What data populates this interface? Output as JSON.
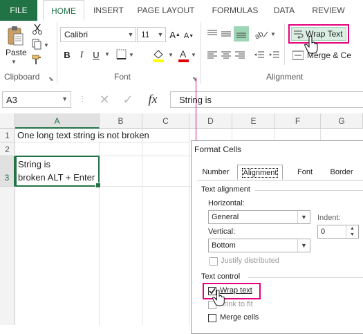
{
  "ribbon_tabs": [
    "FILE",
    "HOME",
    "INSERT",
    "PAGE LAYOUT",
    "FORMULAS",
    "DATA",
    "REVIEW"
  ],
  "clipboard": {
    "paste_label": "Paste",
    "group_label": "Clipboard"
  },
  "font": {
    "name": "Calibri",
    "size": "11",
    "group_label": "Font"
  },
  "alignment": {
    "wrap_text_label": "Wrap Text",
    "merge_label": "Merge & Ce",
    "group_label": "Alignment"
  },
  "formula_bar": {
    "name_box": "A3",
    "fx_label": "fx",
    "content": "String is"
  },
  "sheet": {
    "columns": [
      "A",
      "B",
      "C",
      "D",
      "E",
      "F",
      "G"
    ],
    "rows": [
      "1",
      "2",
      "3"
    ],
    "cells": {
      "A1": "One long text string is not broken",
      "A3_line1": "String is",
      "A3_line2": "broken ALT + Enter"
    }
  },
  "dialog": {
    "title": "Format Cells",
    "tabs": [
      "Number",
      "Alignment",
      "Font",
      "Border"
    ],
    "text_alignment_label": "Text alignment",
    "horizontal_label": "Horizontal:",
    "horizontal_value": "General",
    "indent_label": "Indent:",
    "indent_value": "0",
    "vertical_label": "Vertical:",
    "vertical_value": "Bottom",
    "justify_distributed_label": "Justify distributed",
    "text_control_label": "Text control",
    "wrap_text_label": "Wrap text",
    "wrap_text_checked": true,
    "shrink_label": "hrink to fit",
    "merge_cells_label": "Merge cells"
  },
  "colors": {
    "excel_green": "#217346",
    "highlight": "#e3007d",
    "selected_cell": "#217346"
  }
}
